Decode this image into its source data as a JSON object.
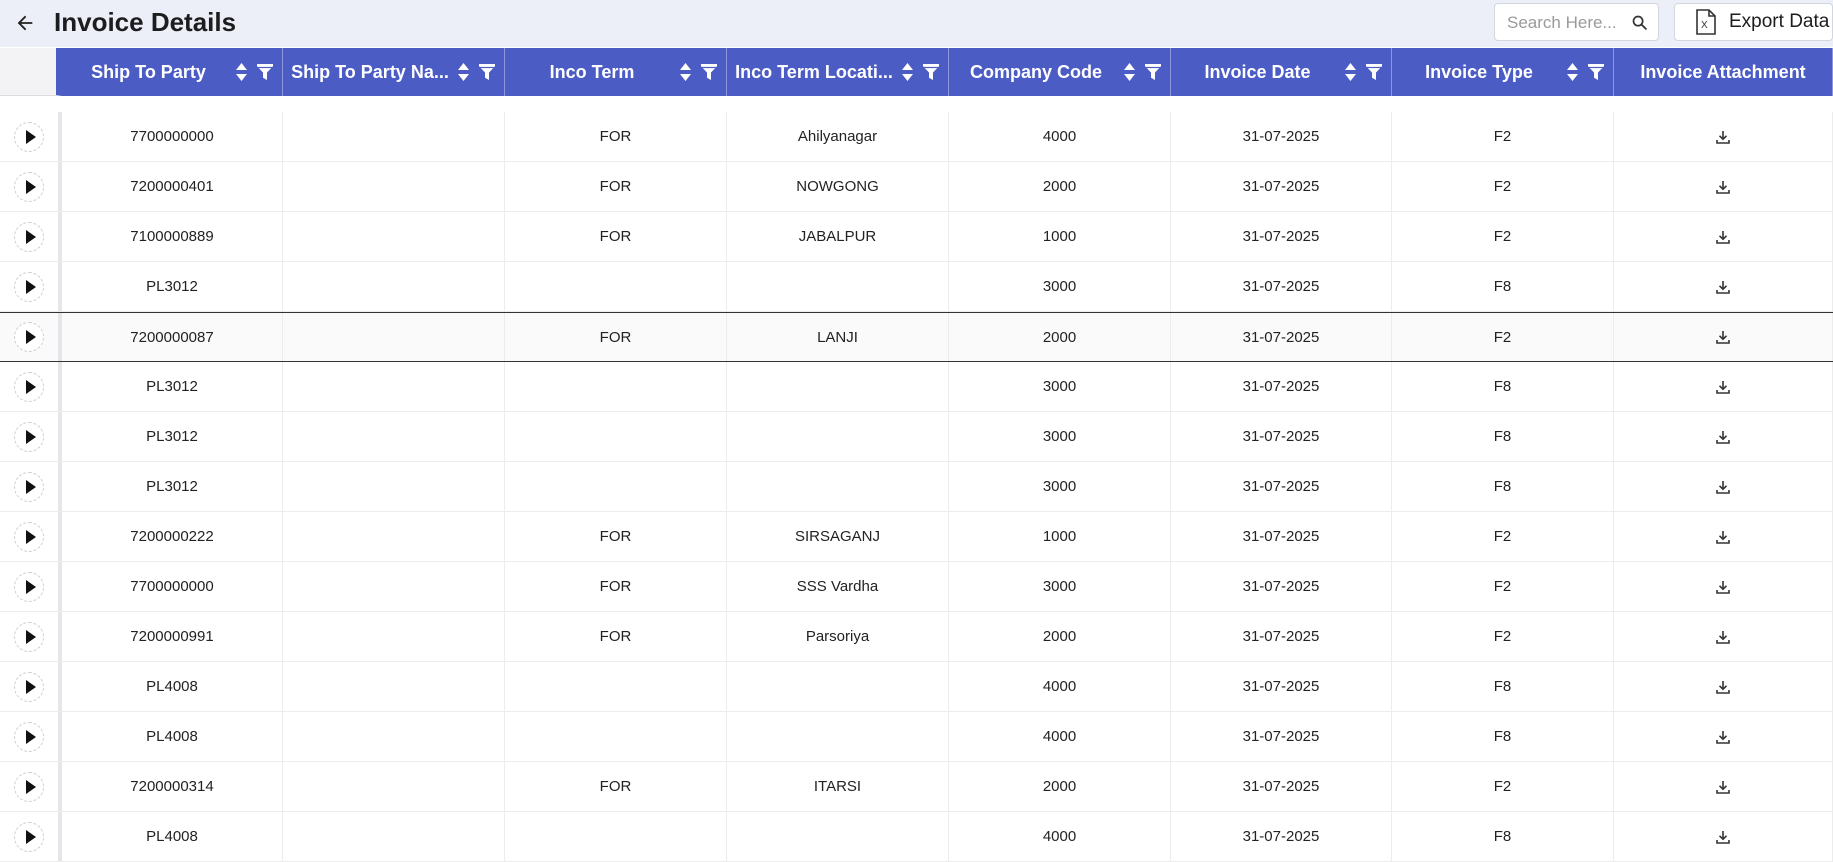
{
  "header": {
    "title": "Invoice Details",
    "search_placeholder": "Search Here...",
    "export_label": "Export Data"
  },
  "columns": [
    {
      "key": "ship_to_party",
      "label": "Ship To Party",
      "width": 221,
      "sortable": true,
      "filterable": true
    },
    {
      "key": "ship_to_party_name",
      "label": "Ship To Party Na...",
      "width": 222,
      "sortable": true,
      "filterable": true
    },
    {
      "key": "inco_term",
      "label": "Inco Term",
      "width": 222,
      "sortable": true,
      "filterable": true
    },
    {
      "key": "inco_term_location",
      "label": "Inco Term Locati...",
      "width": 222,
      "sortable": true,
      "filterable": true
    },
    {
      "key": "company_code",
      "label": "Company Code",
      "width": 222,
      "sortable": true,
      "filterable": true
    },
    {
      "key": "invoice_date",
      "label": "Invoice Date",
      "width": 221,
      "sortable": true,
      "filterable": true
    },
    {
      "key": "invoice_type",
      "label": "Invoice Type",
      "width": 222,
      "sortable": true,
      "filterable": true
    },
    {
      "key": "invoice_attachment",
      "label": "Invoice Attachment",
      "width": 219,
      "sortable": false,
      "filterable": false
    }
  ],
  "rows": [
    {
      "ship_to_party": "7700000000",
      "ship_to_party_name": "",
      "inco_term": "FOR",
      "inco_term_location": "Ahilyanagar",
      "company_code": "4000",
      "invoice_date": "31-07-2025",
      "invoice_type": "F2"
    },
    {
      "ship_to_party": "7200000401",
      "ship_to_party_name": "",
      "inco_term": "FOR",
      "inco_term_location": "NOWGONG",
      "company_code": "2000",
      "invoice_date": "31-07-2025",
      "invoice_type": "F2"
    },
    {
      "ship_to_party": "7100000889",
      "ship_to_party_name": "",
      "inco_term": "FOR",
      "inco_term_location": "JABALPUR",
      "company_code": "1000",
      "invoice_date": "31-07-2025",
      "invoice_type": "F2"
    },
    {
      "ship_to_party": "PL3012",
      "ship_to_party_name": "",
      "inco_term": "",
      "inco_term_location": "",
      "company_code": "3000",
      "invoice_date": "31-07-2025",
      "invoice_type": "F8"
    },
    {
      "ship_to_party": "7200000087",
      "ship_to_party_name": "",
      "inco_term": "FOR",
      "inco_term_location": "LANJI",
      "company_code": "2000",
      "invoice_date": "31-07-2025",
      "invoice_type": "F2",
      "selected": true
    },
    {
      "ship_to_party": "PL3012",
      "ship_to_party_name": "",
      "inco_term": "",
      "inco_term_location": "",
      "company_code": "3000",
      "invoice_date": "31-07-2025",
      "invoice_type": "F8"
    },
    {
      "ship_to_party": "PL3012",
      "ship_to_party_name": "",
      "inco_term": "",
      "inco_term_location": "",
      "company_code": "3000",
      "invoice_date": "31-07-2025",
      "invoice_type": "F8"
    },
    {
      "ship_to_party": "PL3012",
      "ship_to_party_name": "",
      "inco_term": "",
      "inco_term_location": "",
      "company_code": "3000",
      "invoice_date": "31-07-2025",
      "invoice_type": "F8"
    },
    {
      "ship_to_party": "7200000222",
      "ship_to_party_name": "",
      "inco_term": "FOR",
      "inco_term_location": "SIRSAGANJ",
      "company_code": "1000",
      "invoice_date": "31-07-2025",
      "invoice_type": "F2"
    },
    {
      "ship_to_party": "7700000000",
      "ship_to_party_name": "",
      "inco_term": "FOR",
      "inco_term_location": "SSS Vardha",
      "company_code": "3000",
      "invoice_date": "31-07-2025",
      "invoice_type": "F2"
    },
    {
      "ship_to_party": "7200000991",
      "ship_to_party_name": "",
      "inco_term": "FOR",
      "inco_term_location": "Parsoriya",
      "company_code": "2000",
      "invoice_date": "31-07-2025",
      "invoice_type": "F2"
    },
    {
      "ship_to_party": "PL4008",
      "ship_to_party_name": "",
      "inco_term": "",
      "inco_term_location": "",
      "company_code": "4000",
      "invoice_date": "31-07-2025",
      "invoice_type": "F8"
    },
    {
      "ship_to_party": "PL4008",
      "ship_to_party_name": "",
      "inco_term": "",
      "inco_term_location": "",
      "company_code": "4000",
      "invoice_date": "31-07-2025",
      "invoice_type": "F8"
    },
    {
      "ship_to_party": "7200000314",
      "ship_to_party_name": "",
      "inco_term": "FOR",
      "inco_term_location": "ITARSI",
      "company_code": "2000",
      "invoice_date": "31-07-2025",
      "invoice_type": "F2"
    },
    {
      "ship_to_party": "PL4008",
      "ship_to_party_name": "",
      "inco_term": "",
      "inco_term_location": "",
      "company_code": "4000",
      "invoice_date": "31-07-2025",
      "invoice_type": "F8"
    }
  ],
  "icons": {
    "back": "arrow-left-icon",
    "search": "search-icon",
    "export": "excel-file-icon",
    "sort": "sort-icon",
    "filter": "filter-icon",
    "expand": "play-icon",
    "download": "download-icon"
  },
  "colors": {
    "header_bg": "#4c5cc5",
    "topbar_bg": "#eceef8"
  }
}
